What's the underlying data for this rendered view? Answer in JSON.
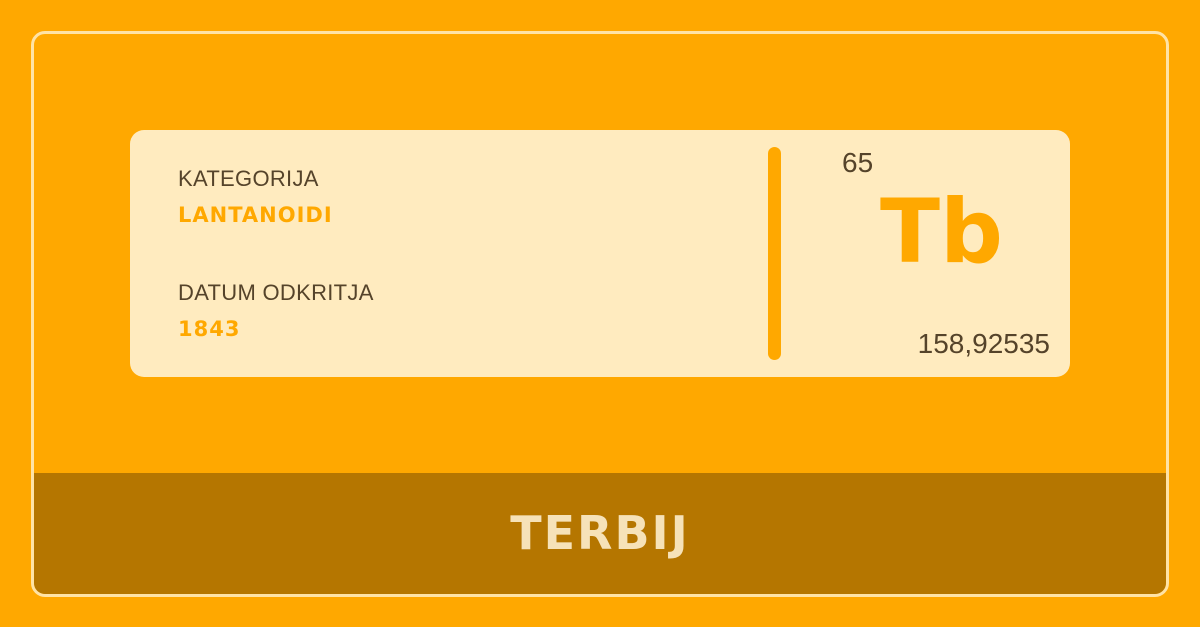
{
  "element": {
    "name": "TERBIJ",
    "symbol": "Tb",
    "atomic_number": "65",
    "atomic_mass": "158,92535"
  },
  "info": {
    "category_label": "KATEGORIJA",
    "category_value": "LANTANOIDI",
    "discovery_label": "DATUM ODKRITJA",
    "discovery_value": "1843"
  },
  "colors": {
    "background": "#FFA800",
    "card": "#FFEBBF",
    "footer": "#B57600",
    "accent": "#FFA800",
    "text_dark": "#55432A",
    "footer_text": "#F6E2B8"
  }
}
